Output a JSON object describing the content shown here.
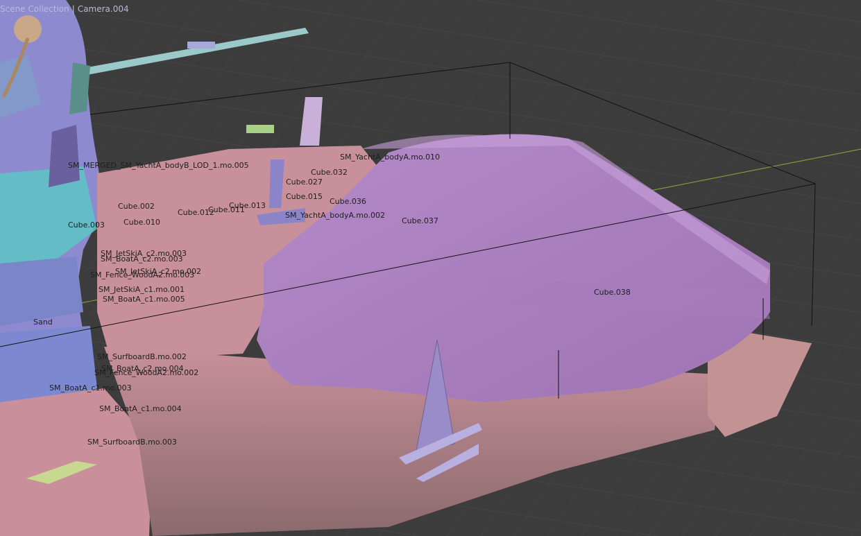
{
  "viewport": {
    "collection": "Scene Collection",
    "camera": "Camera.004"
  },
  "labels": [
    "SM_MERGED_SM_YachtA_bodyB_LOD_1.mo.005",
    "SM_YachtA_bodyA.mo.010",
    "Cube.032",
    "Cube.027",
    "Cube.015",
    "Cube.036",
    "SM_YachtA_bodyA.mo.002",
    "Cube.037",
    "Cube.038",
    "Cube.002",
    "Cube.012",
    "Cube.013",
    "Cube.011",
    "Cube.003",
    "Cube.010",
    "SM_JetSkiA_c2.mo.003",
    "SM_BoatA_c2.mo.003",
    "SM_JetSkiA_c2.mo.002",
    "SM_Fence_WoodA2.mo.003",
    "SM_JetSkiA_c1.mo.001",
    "SM_BoatA_c1.mo.005",
    "Sand",
    "SM_SurfboardB.mo.002",
    "SM_BoatA_c2.mo.004",
    "SM_Fence_WoodA2.mo.002",
    "SM_BoatA_c1.mo.003",
    "SM_BoatA_c1.mo.004",
    "SM_SurfboardB.mo.003"
  ]
}
